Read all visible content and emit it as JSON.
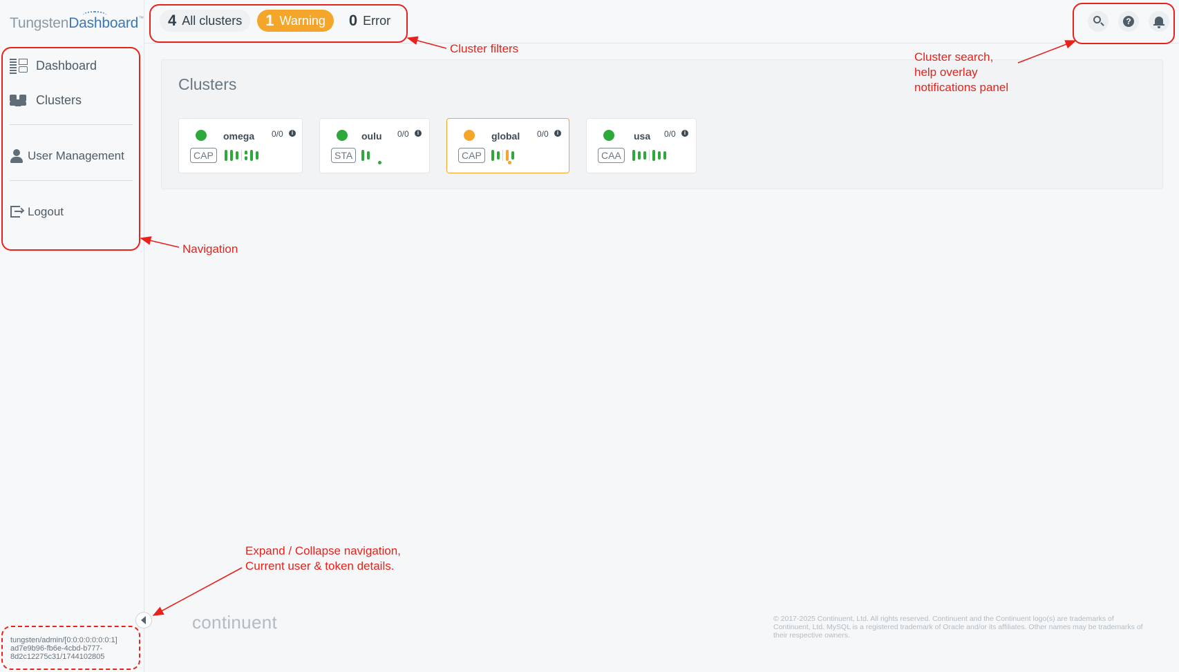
{
  "brand": {
    "part1": "Tungsten",
    "part2": "Dashboard",
    "tm": "™"
  },
  "nav": {
    "dashboard": "Dashboard",
    "clusters": "Clusters",
    "user_management": "User Management",
    "logout": "Logout"
  },
  "filters": {
    "all": {
      "count": "4",
      "label": "All clusters"
    },
    "warning": {
      "count": "1",
      "label": "Warning"
    },
    "error": {
      "count": "0",
      "label": "Error"
    }
  },
  "top_icons": [
    "search-icon",
    "help-icon",
    "bell-icon"
  ],
  "panel": {
    "title": "Clusters"
  },
  "clusters": [
    {
      "name": "omega",
      "ratio": "0/0",
      "type": "CAP",
      "status": "ok"
    },
    {
      "name": "oulu",
      "ratio": "0/0",
      "type": "STA",
      "status": "ok"
    },
    {
      "name": "global",
      "ratio": "0/0",
      "type": "CAP",
      "status": "warning"
    },
    {
      "name": "usa",
      "ratio": "0/0",
      "type": "CAA",
      "status": "ok"
    }
  ],
  "user": {
    "line1": "tungsten/admin/[0:0:0:0:0:0:0:1]",
    "line2": "ad7e9b96-fb6e-4cbd-b777-",
    "line3": "8d2c12275c31/1744102805"
  },
  "footer": {
    "logo": "continuent",
    "copyright": "© 2017-2025 Continuent, Ltd. All rights reserved. Continuent and the Continuent logo(s) are trademarks of Continuent, Ltd. MySQL is a registered trademark of Oracle and/or its affiliates. Other names may be trademarks of their respective owners."
  },
  "annotations": {
    "filters": "Cluster filters",
    "search_line1": "Cluster search,",
    "search_line2": "help overlay",
    "search_line3": "notifications panel",
    "navigation": "Navigation",
    "collapse_line1": "Expand / Collapse navigation,",
    "collapse_line2": "Current user & token details."
  },
  "colors": {
    "ok": "#2ea83a",
    "warning": "#f4a62a",
    "annotation": "#e8211a",
    "brand": "#3a78b5"
  }
}
